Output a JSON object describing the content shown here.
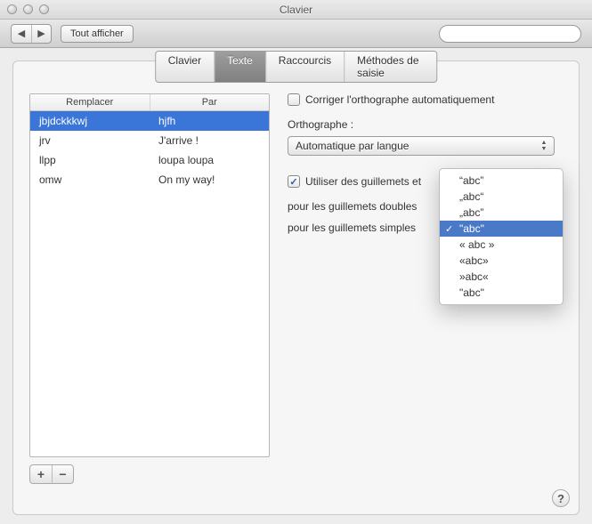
{
  "window": {
    "title": "Clavier"
  },
  "toolbar": {
    "show_all_label": "Tout afficher",
    "search_placeholder": ""
  },
  "tabs": [
    {
      "label": "Clavier",
      "active": false
    },
    {
      "label": "Texte",
      "active": true
    },
    {
      "label": "Raccourcis",
      "active": false
    },
    {
      "label": "Méthodes de saisie",
      "active": false
    }
  ],
  "table": {
    "headers": {
      "replace": "Remplacer",
      "with": "Par"
    },
    "rows": [
      {
        "replace": "jbjdckkkwj",
        "with": "hjfh",
        "selected": true
      },
      {
        "replace": "jrv",
        "with": "J'arrive !",
        "selected": false
      },
      {
        "replace": "llpp",
        "with": "loupa loupa",
        "selected": false
      },
      {
        "replace": "omw",
        "with": "On my way!",
        "selected": false
      }
    ],
    "add_label": "+",
    "remove_label": "−"
  },
  "right": {
    "spellcheck_label": "Corriger l'orthographe automatiquement",
    "spellcheck_checked": false,
    "spelling_header": "Orthographe :",
    "spelling_value": "Automatique par langue",
    "smart_quotes_label": "Utiliser des guillemets et",
    "smart_quotes_checked": true,
    "double_quotes_label": "pour les guillemets doubles",
    "single_quotes_label": "pour les guillemets simples"
  },
  "quote_menu": {
    "items": [
      {
        "label": "“abc”",
        "selected": false
      },
      {
        "label": "„abc“",
        "selected": false
      },
      {
        "label": "„abc”",
        "selected": false
      },
      {
        "label": "\"abc\"",
        "selected": true
      },
      {
        "label": "« abc »",
        "selected": false
      },
      {
        "label": "«abc»",
        "selected": false
      },
      {
        "label": "»abc«",
        "selected": false
      },
      {
        "label": "\"abc\"",
        "selected": false
      }
    ]
  },
  "help_label": "?"
}
